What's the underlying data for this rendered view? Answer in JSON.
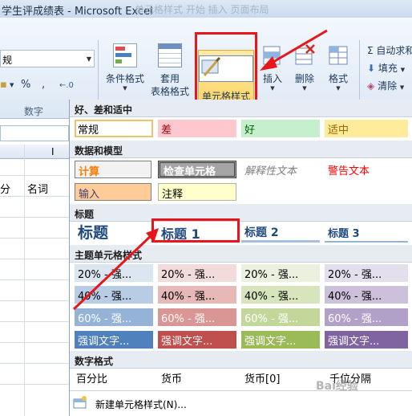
{
  "window": {
    "title": "学生评成绩表 - Microsoft Excel",
    "ghost_title": "单元格样式   开始 插入 页面布局"
  },
  "ribbon": {
    "font_name": "规",
    "number_symbols": [
      "%",
      ","
    ],
    "number_group_label": "数字",
    "buttons": {
      "conditional_format": "条件格式",
      "format_as_table_line1": "套用",
      "format_as_table_line2": "表格格式",
      "cell_styles": "单元格样式",
      "insert": "插入",
      "delete": "删除",
      "format": "格式"
    },
    "small_buttons": {
      "autosum": "Σ 自动求和",
      "fill": "填充",
      "clear": "清除"
    }
  },
  "sheet": {
    "cells": [
      "分",
      "名词"
    ],
    "cursor_glyph": "I"
  },
  "gallery": {
    "sections": {
      "good_bad_neutral": "好、差和适中",
      "data_model": "数据和模型",
      "titles": "标题",
      "theme_styles": "主题单元格样式",
      "number_format": "数字格式"
    },
    "good_bad_neutral": [
      "常规",
      "差",
      "好",
      "适中"
    ],
    "data_model_row1": [
      "计算",
      "检查单元格",
      "解释性文本",
      "警告文本"
    ],
    "data_model_row2": [
      "输入",
      "注释"
    ],
    "titles": [
      "标题",
      "标题 1",
      "标题 2",
      "标题 3"
    ],
    "theme_20": [
      "20% - 强...",
      "20% - 强...",
      "20% - 强...",
      "20% - 强..."
    ],
    "theme_40": [
      "40% - 强...",
      "40% - 强...",
      "40% - 强...",
      "40% - 强..."
    ],
    "theme_60": [
      "60% - 强...",
      "60% - 强...",
      "60% - 强...",
      "60% - 强..."
    ],
    "theme_accent": [
      "强调文字...",
      "强调文字...",
      "强调文字...",
      "强调文字..."
    ],
    "number_format": [
      "百分比",
      "货币",
      "货币[0]",
      "千位分隔"
    ],
    "new_style": "新建单元格样式(N)..."
  },
  "colors": {
    "highlight_red": "#e8161b",
    "accent_20": [
      "#dce6f1",
      "#f2dcdb",
      "#ebf1de",
      "#e4dfec"
    ],
    "accent_40": [
      "#b8cce4",
      "#e6b8b7",
      "#d8e4bc",
      "#ccc0da"
    ],
    "accent_60": [
      "#95b3d7",
      "#da9694",
      "#c4d79b",
      "#b1a0c7"
    ],
    "accent_full": [
      "#4f81bd",
      "#c0504d",
      "#9bbb59",
      "#8064a2"
    ]
  },
  "watermark": "Bai经验"
}
